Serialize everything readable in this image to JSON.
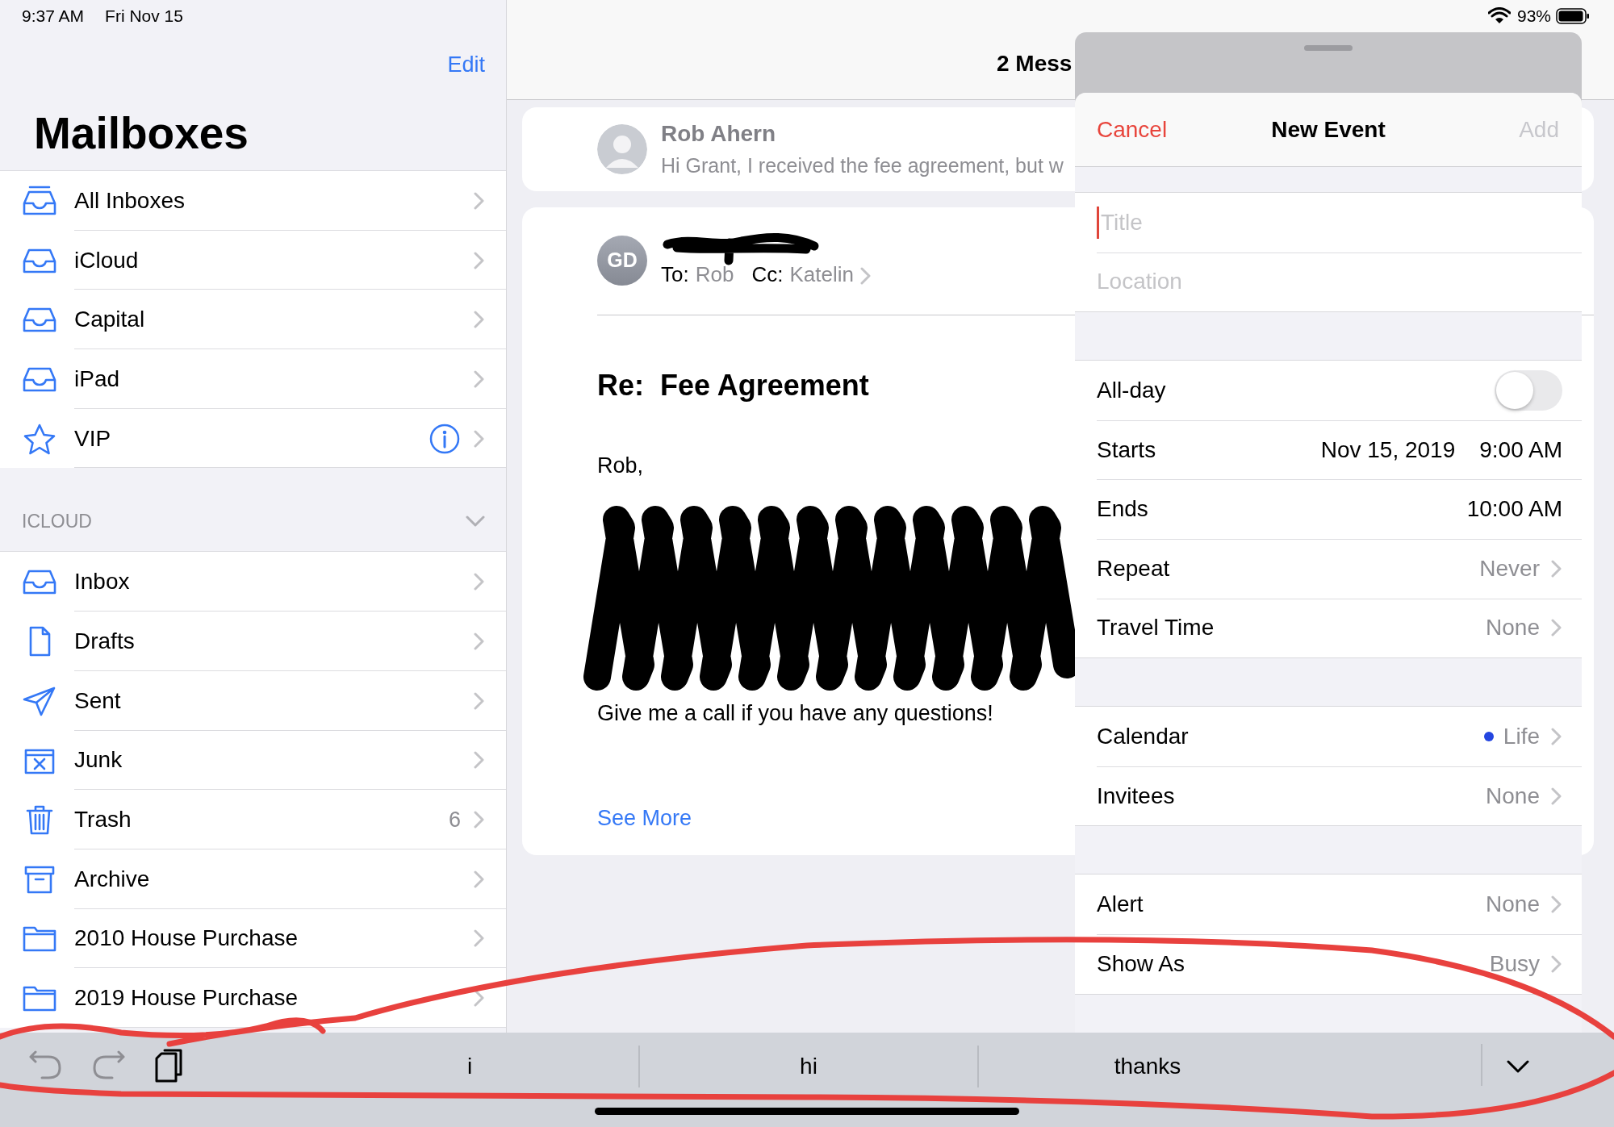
{
  "status_bar": {
    "time": "9:37 AM",
    "date": "Fri Nov 15",
    "battery": "93%"
  },
  "sidebar": {
    "edit": "Edit",
    "title": "Mailboxes",
    "mailboxes": [
      {
        "kind": "tray-stack",
        "label": "All Inboxes",
        "info": false
      },
      {
        "kind": "tray",
        "label": "iCloud",
        "info": false
      },
      {
        "kind": "tray",
        "label": "Capital",
        "info": false
      },
      {
        "kind": "tray",
        "label": "iPad",
        "info": false
      },
      {
        "kind": "star",
        "label": "VIP",
        "info": true
      }
    ],
    "section": {
      "header": "ICLOUD",
      "expanded": true,
      "items": [
        {
          "kind": "tray",
          "label": "Inbox"
        },
        {
          "kind": "document",
          "label": "Drafts"
        },
        {
          "kind": "plane",
          "label": "Sent"
        },
        {
          "kind": "junk",
          "label": "Junk"
        },
        {
          "kind": "trash",
          "label": "Trash",
          "count": "6"
        },
        {
          "kind": "archive",
          "label": "Archive"
        },
        {
          "kind": "folder",
          "label": "2010 House Purchase"
        },
        {
          "kind": "folder",
          "label": "2019 House Purchase"
        }
      ]
    }
  },
  "thread": {
    "title": "2 Mess",
    "messages": [
      {
        "sender": "Rob Ahern",
        "preview": "Hi Grant, I received the fee agreement, but w"
      }
    ],
    "open_message": {
      "initials": "GD",
      "to_label": "To:",
      "to": "Rob",
      "cc_label": "Cc:",
      "cc": "Katelin",
      "subject": "Re:  Fee Agreement",
      "greeting": "Rob,",
      "closing": "Give me a call if you have any questions!",
      "see_more": "See More"
    }
  },
  "event": {
    "cancel": "Cancel",
    "title": "New Event",
    "add": {
      "label": "Add",
      "disabled": true
    },
    "fields": [
      {
        "placeholder": "Title",
        "focused": true
      },
      {
        "placeholder": "Location",
        "focused": false
      }
    ],
    "groups": [
      [
        {
          "kind": "toggle",
          "label": "All-day",
          "on": false
        },
        {
          "kind": "datetime",
          "label": "Starts",
          "date": "Nov 15, 2019",
          "time": "9:00 AM"
        },
        {
          "kind": "datetime",
          "label": "Ends",
          "time": "10:00 AM"
        },
        {
          "kind": "disclosure",
          "label": "Repeat",
          "value": "Never"
        },
        {
          "kind": "disclosure",
          "label": "Travel Time",
          "value": "None"
        }
      ],
      [
        {
          "kind": "disclosure",
          "label": "Calendar",
          "value": "Life",
          "color": "#2446e0"
        },
        {
          "kind": "disclosure",
          "label": "Invitees",
          "value": "None"
        }
      ],
      [
        {
          "kind": "disclosure",
          "label": "Alert",
          "value": "None"
        },
        {
          "kind": "disclosure",
          "label": "Show As",
          "value": "Busy"
        }
      ]
    ]
  },
  "keyboard": {
    "tools": [
      {
        "kind": "undo",
        "disabled": true
      },
      {
        "kind": "redo",
        "disabled": true
      },
      {
        "kind": "paste",
        "disabled": false
      }
    ],
    "suggestions": [
      "i",
      "hi",
      "thanks"
    ]
  }
}
